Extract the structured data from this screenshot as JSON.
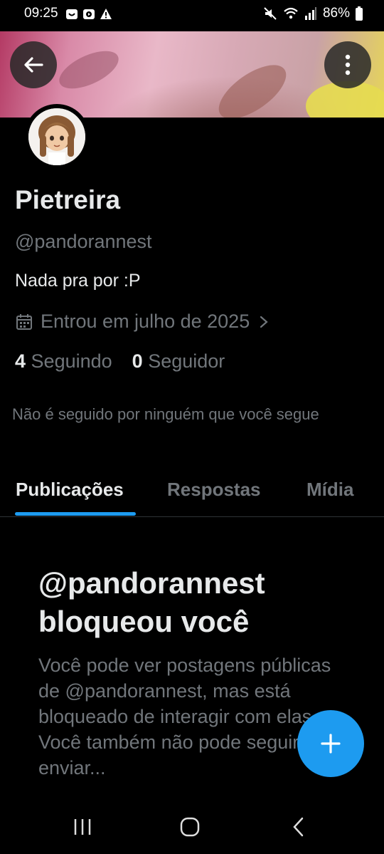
{
  "status_bar": {
    "time": "09:25",
    "battery": "86%",
    "icons_left": [
      "notification-icon",
      "youtube-icon",
      "warning-icon"
    ],
    "icons_right": [
      "mute-icon",
      "wifi-icon",
      "signal-icon",
      "battery-icon"
    ]
  },
  "header": {
    "back_icon": "back-arrow-icon",
    "more_icon": "more-vertical-icon"
  },
  "profile": {
    "display_name": "Pietreira",
    "handle": "@pandorannest",
    "bio": "Nada pra por :P",
    "joined": "Entrou em julho de 2025",
    "following_count": "4",
    "following_label": "Seguindo",
    "followers_count": "0",
    "followers_label": "Seguidor",
    "not_followed_note": "Não é seguido por ninguém que você segue"
  },
  "tabs": [
    {
      "label": "Publicações",
      "active": true
    },
    {
      "label": "Respostas",
      "active": false
    },
    {
      "label": "Mídia",
      "active": false
    }
  ],
  "blocked": {
    "title": "@pandorannest bloqueou você",
    "body": "Você pode ver postagens públicas de @pandorannest, mas está bloqueado de interagir com elas. Você também não pode seguir ou enviar..."
  },
  "fab": {
    "icon": "plus-icon"
  },
  "colors": {
    "accent": "#1d9bf0",
    "background": "#000000",
    "primary_text": "#e7e9ea",
    "secondary_text": "#71767b"
  }
}
